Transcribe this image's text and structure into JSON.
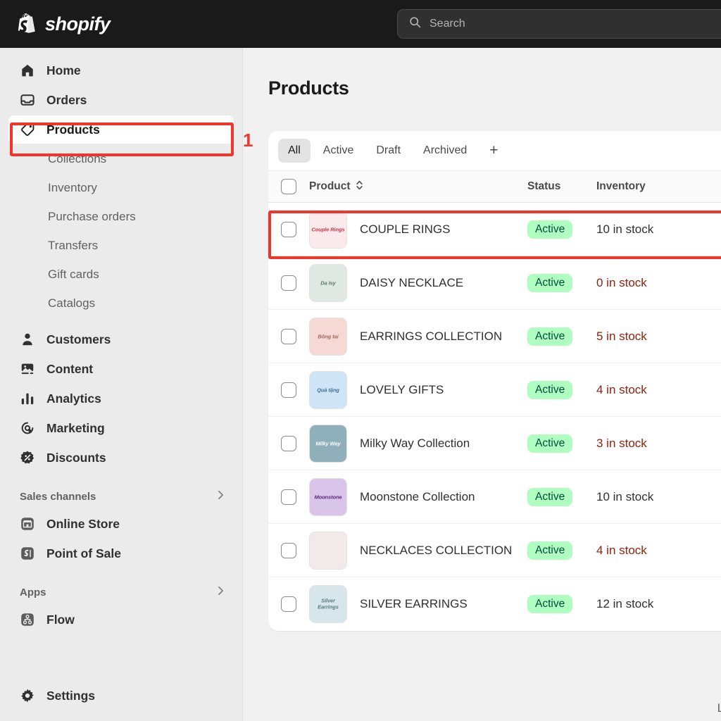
{
  "topbar": {
    "brand_name": "shopify",
    "brand_icon": "shopify-bag-logo",
    "search": {
      "icon": "search-icon",
      "placeholder": "Search",
      "value": ""
    }
  },
  "sidebar": {
    "primary": [
      {
        "label": "Home",
        "icon": "home-icon",
        "active": false
      },
      {
        "label": "Orders",
        "icon": "orders-inbox-icon",
        "active": false
      },
      {
        "label": "Products",
        "icon": "product-tag-icon",
        "active": true
      }
    ],
    "product_subitems": [
      {
        "label": "Collections"
      },
      {
        "label": "Inventory"
      },
      {
        "label": "Purchase orders"
      },
      {
        "label": "Transfers"
      },
      {
        "label": "Gift cards"
      },
      {
        "label": "Catalogs"
      }
    ],
    "secondary": [
      {
        "label": "Customers",
        "icon": "customer-person-icon"
      },
      {
        "label": "Content",
        "icon": "content-image-icon"
      },
      {
        "label": "Analytics",
        "icon": "analytics-bars-icon"
      },
      {
        "label": "Marketing",
        "icon": "marketing-target-icon"
      },
      {
        "label": "Discounts",
        "icon": "discount-badge-icon"
      }
    ],
    "sales_channels": {
      "title": "Sales channels",
      "chevron": "chevron-right-icon",
      "items": [
        {
          "label": "Online Store",
          "icon": "online-store-icon"
        },
        {
          "label": "Point of Sale",
          "icon": "point-of-sale-icon"
        }
      ]
    },
    "apps": {
      "title": "Apps",
      "chevron": "chevron-right-icon",
      "items": [
        {
          "label": "Flow",
          "icon": "flow-app-icon"
        }
      ]
    },
    "settings": {
      "label": "Settings",
      "icon": "gear-icon"
    }
  },
  "main": {
    "page_title": "Products",
    "tabs": [
      {
        "label": "All",
        "selected": true
      },
      {
        "label": "Active",
        "selected": false
      },
      {
        "label": "Draft",
        "selected": false
      },
      {
        "label": "Archived",
        "selected": false
      }
    ],
    "tab_add_label": "+",
    "table": {
      "headers": {
        "select_all": "select-all-checkbox",
        "product": "Product",
        "sort_icon": "sort-updown-icon",
        "status": "Status",
        "inventory": "Inventory"
      },
      "rows": [
        {
          "name": "COUPLE RINGS",
          "status": "Active",
          "inventory": "10 in stock",
          "low": false,
          "thumb_text": "Couple Rings",
          "thumb_bg": "#fbe9ec",
          "thumb_fg": "#c9364f",
          "highlighted": true
        },
        {
          "name": "DAISY NECKLACE",
          "status": "Active",
          "inventory": "0 in stock",
          "low": true,
          "thumb_text": "Da Isy",
          "thumb_bg": "#dfe9e2",
          "thumb_fg": "#5c7566",
          "highlighted": false
        },
        {
          "name": "EARRINGS COLLECTION",
          "status": "Active",
          "inventory": "5 in stock",
          "low": true,
          "thumb_text": "Bông tai",
          "thumb_bg": "#f6d8d4",
          "thumb_fg": "#9d6a62",
          "highlighted": false
        },
        {
          "name": "LOVELY GIFTS",
          "status": "Active",
          "inventory": "4 in stock",
          "low": true,
          "thumb_text": "Quà tặng",
          "thumb_bg": "#cfe4f5",
          "thumb_fg": "#3f6f9e",
          "highlighted": false
        },
        {
          "name": "Milky Way Collection",
          "status": "Active",
          "inventory": "3 in stock",
          "low": true,
          "thumb_text": "Milky Way",
          "thumb_bg": "#8fb0bb",
          "thumb_fg": "#ffffff",
          "highlighted": false
        },
        {
          "name": "Moonstone Collection",
          "status": "Active",
          "inventory": "10 in stock",
          "low": false,
          "thumb_text": "Moonstone",
          "thumb_bg": "#d9c4ea",
          "thumb_fg": "#5b2a7a",
          "highlighted": false
        },
        {
          "name": "NECKLACES COLLECTION",
          "status": "Active",
          "inventory": "4 in stock",
          "low": true,
          "thumb_text": "",
          "thumb_bg": "#f2eaea",
          "thumb_fg": "#8a6a6a",
          "highlighted": false
        },
        {
          "name": "SILVER EARRINGS",
          "status": "Active",
          "inventory": "12 in stock",
          "low": false,
          "thumb_text": "Silver Earrings",
          "thumb_bg": "#d6e6ea",
          "thumb_fg": "#5a7c86",
          "highlighted": false
        }
      ]
    },
    "footer_link": "Learn m"
  },
  "annotations": [
    {
      "number": "1",
      "target": "sidebar-products-item"
    }
  ],
  "colors": {
    "annotation_red": "#f0352b",
    "badge_bg": "#affebf",
    "badge_text": "#014b40",
    "low_stock_text": "#8e1f0b",
    "topbar_bg": "#1a1a1a",
    "sidebar_bg": "#ebebeb",
    "page_bg": "#f1f1f1"
  }
}
